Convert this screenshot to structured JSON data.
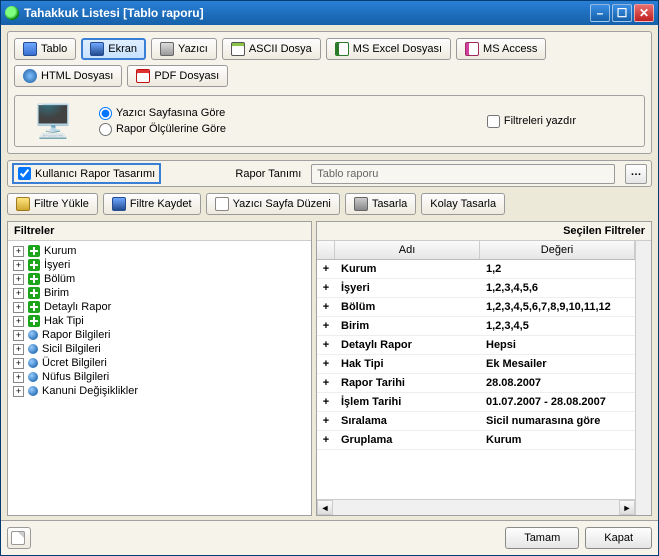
{
  "window": {
    "title": "Tahakkuk Listesi [Tablo raporu]"
  },
  "toolbar": {
    "tablo": "Tablo",
    "ekran": "Ekran",
    "yazici": "Yazıcı",
    "ascii": "ASCII Dosya",
    "excel": "MS Excel Dosyası",
    "access": "MS Access",
    "html": "HTML Dosyası",
    "pdf": "PDF Dosyası"
  },
  "options": {
    "radio_yazici": "Yazıcı Sayfasına Göre",
    "radio_rapor": "Rapor Ölçülerine Göre",
    "chk_filtre": "Filtreleri yazdır"
  },
  "tanim": {
    "chk_label": "Kullanıcı Rapor Tasarımı",
    "label": "Rapor Tanımı",
    "value": "Tablo raporu"
  },
  "actions": {
    "yukle": "Filtre Yükle",
    "kaydet": "Filtre Kaydet",
    "sayfa": "Yazıcı Sayfa Düzeni",
    "tasarla": "Tasarla",
    "kolay": "Kolay Tasarla"
  },
  "left": {
    "title": "Filtreler",
    "items": [
      {
        "icon": "green",
        "label": "Kurum"
      },
      {
        "icon": "green",
        "label": "İşyeri"
      },
      {
        "icon": "green",
        "label": "Bölüm"
      },
      {
        "icon": "green",
        "label": "Birim"
      },
      {
        "icon": "green",
        "label": "Detaylı Rapor"
      },
      {
        "icon": "green",
        "label": "Hak Tipi"
      },
      {
        "icon": "blue",
        "label": "Rapor Bilgileri"
      },
      {
        "icon": "blue",
        "label": "Sicil Bilgileri"
      },
      {
        "icon": "blue",
        "label": "Ücret Bilgileri"
      },
      {
        "icon": "blue",
        "label": "Nüfus Bilgileri"
      },
      {
        "icon": "blue",
        "label": "Kanuni Değişiklikler"
      }
    ]
  },
  "right": {
    "title": "Seçilen Filtreler",
    "col_name": "Adı",
    "col_value": "Değeri",
    "rows": [
      {
        "name": "Kurum",
        "value": "1,2"
      },
      {
        "name": "İşyeri",
        "value": "1,2,3,4,5,6"
      },
      {
        "name": "Bölüm",
        "value": "1,2,3,4,5,6,7,8,9,10,11,12"
      },
      {
        "name": "Birim",
        "value": "1,2,3,4,5"
      },
      {
        "name": "Detaylı Rapor",
        "value": "Hepsi"
      },
      {
        "name": "Hak Tipi",
        "value": "Ek Mesailer"
      },
      {
        "name": "Rapor Tarihi",
        "value": "28.08.2007"
      },
      {
        "name": "İşlem Tarihi",
        "value": "01.07.2007 - 28.08.2007"
      },
      {
        "name": "Sıralama",
        "value": "Sicil numarasına göre"
      },
      {
        "name": "Gruplama",
        "value": "Kurum"
      }
    ]
  },
  "footer": {
    "ok": "Tamam",
    "cancel": "Kapat"
  }
}
